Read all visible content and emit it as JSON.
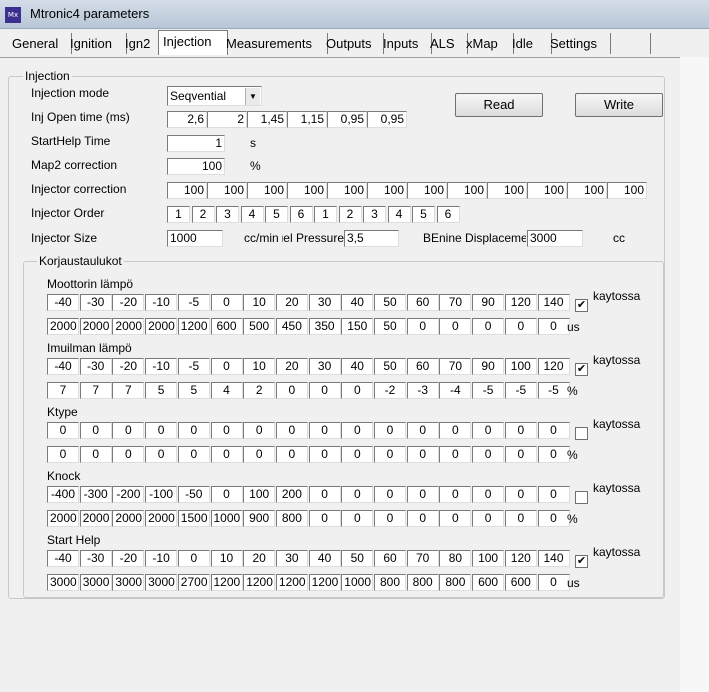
{
  "window": {
    "title": "Mtronic4 parameters",
    "icon": "app-icon"
  },
  "tabs": [
    {
      "label": "General"
    },
    {
      "label": "Ignition"
    },
    {
      "label": "Ign2"
    },
    {
      "label": "Injection",
      "active": true
    },
    {
      "label": "Measurements"
    },
    {
      "label": "Outputs"
    },
    {
      "label": "Inputs"
    },
    {
      "label": "ALS"
    },
    {
      "label": "xMap"
    },
    {
      "label": "Idle"
    },
    {
      "label": "Settings"
    },
    {
      "label": ""
    }
  ],
  "injection": {
    "group_label": "Injection",
    "mode_label": "Injection mode",
    "mode_value": "Seqvential",
    "open_time_label": "Inj Open time (ms)",
    "open_time_values": [
      "2,6",
      "2",
      "1,45",
      "1,15",
      "0,95",
      "0,95"
    ],
    "starthelp_label": "StartHelp Time",
    "starthelp_value": "1",
    "starthelp_unit": "s",
    "map2_label": "Map2 correction",
    "map2_value": "100",
    "map2_unit": "%",
    "injcorr_label": "Injector correction",
    "injcorr_values": [
      "100",
      "100",
      "100",
      "100",
      "100",
      "100",
      "100",
      "100",
      "100",
      "100",
      "100",
      "100"
    ],
    "order_label": "Injector Order",
    "order_values": [
      "1",
      "2",
      "3",
      "4",
      "5",
      "6",
      "1",
      "2",
      "3",
      "4",
      "5",
      "6"
    ],
    "size_label": "Injector Size",
    "size_value": "1000",
    "size_unit": "cc/min",
    "fuel_label": "Fuel Pressure",
    "fuel_value": "3,5",
    "disp_label": "BEnine Displacement",
    "disp_value": "3000",
    "disp_unit": "cc",
    "read_label": "Read",
    "write_label": "Write"
  },
  "korjaus": {
    "group_label": "Korjaustaulukot",
    "tables": [
      {
        "label": "Moottorin lämpö",
        "row1": [
          "-40",
          "-30",
          "-20",
          "-10",
          "-5",
          "0",
          "10",
          "20",
          "30",
          "40",
          "50",
          "60",
          "70",
          "90",
          "120",
          "140"
        ],
        "row2": [
          "2000",
          "2000",
          "2000",
          "2000",
          "1200",
          "600",
          "500",
          "450",
          "350",
          "150",
          "50",
          "0",
          "0",
          "0",
          "0",
          "0"
        ],
        "unit": "us",
        "checked": true,
        "check_label": "kaytossa"
      },
      {
        "label": "Imuilman lämpö",
        "row1": [
          "-40",
          "-30",
          "-20",
          "-10",
          "-5",
          "0",
          "10",
          "20",
          "30",
          "40",
          "50",
          "60",
          "70",
          "90",
          "100",
          "120"
        ],
        "row2": [
          "7",
          "7",
          "7",
          "5",
          "5",
          "4",
          "2",
          "0",
          "0",
          "0",
          "-2",
          "-3",
          "-4",
          "-5",
          "-5",
          "-5"
        ],
        "unit": "%",
        "checked": true,
        "check_label": "kaytossa"
      },
      {
        "label": "Ktype",
        "row1": [
          "0",
          "0",
          "0",
          "0",
          "0",
          "0",
          "0",
          "0",
          "0",
          "0",
          "0",
          "0",
          "0",
          "0",
          "0",
          "0"
        ],
        "row2": [
          "0",
          "0",
          "0",
          "0",
          "0",
          "0",
          "0",
          "0",
          "0",
          "0",
          "0",
          "0",
          "0",
          "0",
          "0",
          "0"
        ],
        "unit": "%",
        "checked": false,
        "check_label": "kaytossa"
      },
      {
        "label": "Knock",
        "row1": [
          "-400",
          "-300",
          "-200",
          "-100",
          "-50",
          "0",
          "100",
          "200",
          "0",
          "0",
          "0",
          "0",
          "0",
          "0",
          "0",
          "0"
        ],
        "row2": [
          "2000",
          "2000",
          "2000",
          "2000",
          "1500",
          "1000",
          "900",
          "800",
          "0",
          "0",
          "0",
          "0",
          "0",
          "0",
          "0",
          "0"
        ],
        "unit": "%",
        "checked": false,
        "check_label": "kaytossa"
      },
      {
        "label": "Start Help",
        "row1": [
          "-40",
          "-30",
          "-20",
          "-10",
          "0",
          "10",
          "20",
          "30",
          "40",
          "50",
          "60",
          "70",
          "80",
          "100",
          "120",
          "140"
        ],
        "row2": [
          "3000",
          "3000",
          "3000",
          "3000",
          "2700",
          "1200",
          "1200",
          "1200",
          "1200",
          "1000",
          "800",
          "800",
          "800",
          "600",
          "600",
          "0"
        ],
        "unit": "us",
        "checked": true,
        "check_label": "kaytossa"
      }
    ]
  }
}
